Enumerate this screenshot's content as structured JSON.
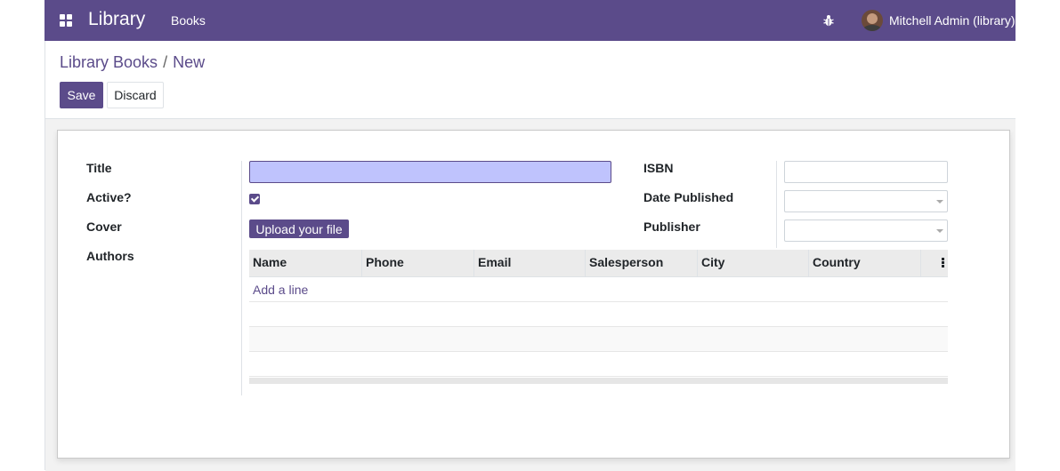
{
  "navbar": {
    "app_name": "Library",
    "menu_books": "Books",
    "user_name": "Mitchell Admin (library)",
    "apps_icon": "apps-grid-icon",
    "debug_icon": "bug-icon",
    "bg_color": "#5b4b8a"
  },
  "breadcrumb": {
    "parent": "Library Books",
    "separator": "/",
    "current": "New"
  },
  "buttons": {
    "save": "Save",
    "discard": "Discard"
  },
  "form": {
    "title_label": "Title",
    "title_value": "",
    "active_label": "Active?",
    "active_checked": true,
    "cover_label": "Cover",
    "upload_label": "Upload your file",
    "authors_label": "Authors",
    "isbn_label": "ISBN",
    "isbn_value": "",
    "date_label": "Date Published",
    "date_value": "",
    "publisher_label": "Publisher",
    "publisher_value": ""
  },
  "authors_table": {
    "columns": [
      "Name",
      "Phone",
      "Email",
      "Salesperson",
      "City",
      "Country"
    ],
    "add_line": "Add a line",
    "options_icon": "kebab-vertical-icon"
  }
}
